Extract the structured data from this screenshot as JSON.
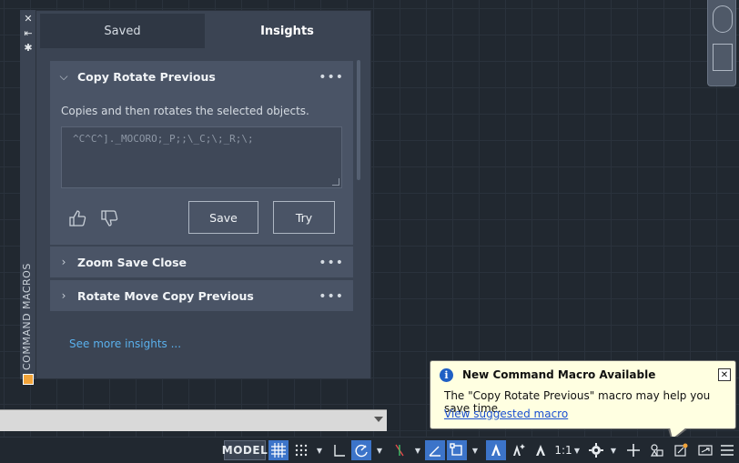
{
  "palette": {
    "side_title": "COMMAND MACROS",
    "tabs": [
      {
        "label": "Saved",
        "active": false
      },
      {
        "label": "Insights",
        "active": true
      }
    ],
    "cards": [
      {
        "title": "Copy Rotate Previous",
        "expanded": true,
        "description": "Copies and then rotates the selected objects.",
        "macro": "^C^C^]._MOCORO;_P;;\\_C;\\;_R;\\;",
        "save_label": "Save",
        "try_label": "Try"
      },
      {
        "title": "Zoom Save Close",
        "expanded": false
      },
      {
        "title": "Rotate Move Copy Previous",
        "expanded": false
      }
    ],
    "more_glyph": "•••",
    "see_more": "See more insights ..."
  },
  "statusbar": {
    "model_label": "MODEL",
    "scale_label": "1:1"
  },
  "notification": {
    "title": "New Command Macro Available",
    "message": "The \"Copy Rotate Previous\" macro may help you save time.",
    "link": "View suggested macro"
  },
  "colors": {
    "canvas_bg": "#212830",
    "panel_bg": "#3b4453",
    "card_bg": "#4a5466",
    "accent_active": "#3c74c9",
    "link_blue": "#5ab0ec",
    "balloon_bg": "#ffffe1"
  }
}
